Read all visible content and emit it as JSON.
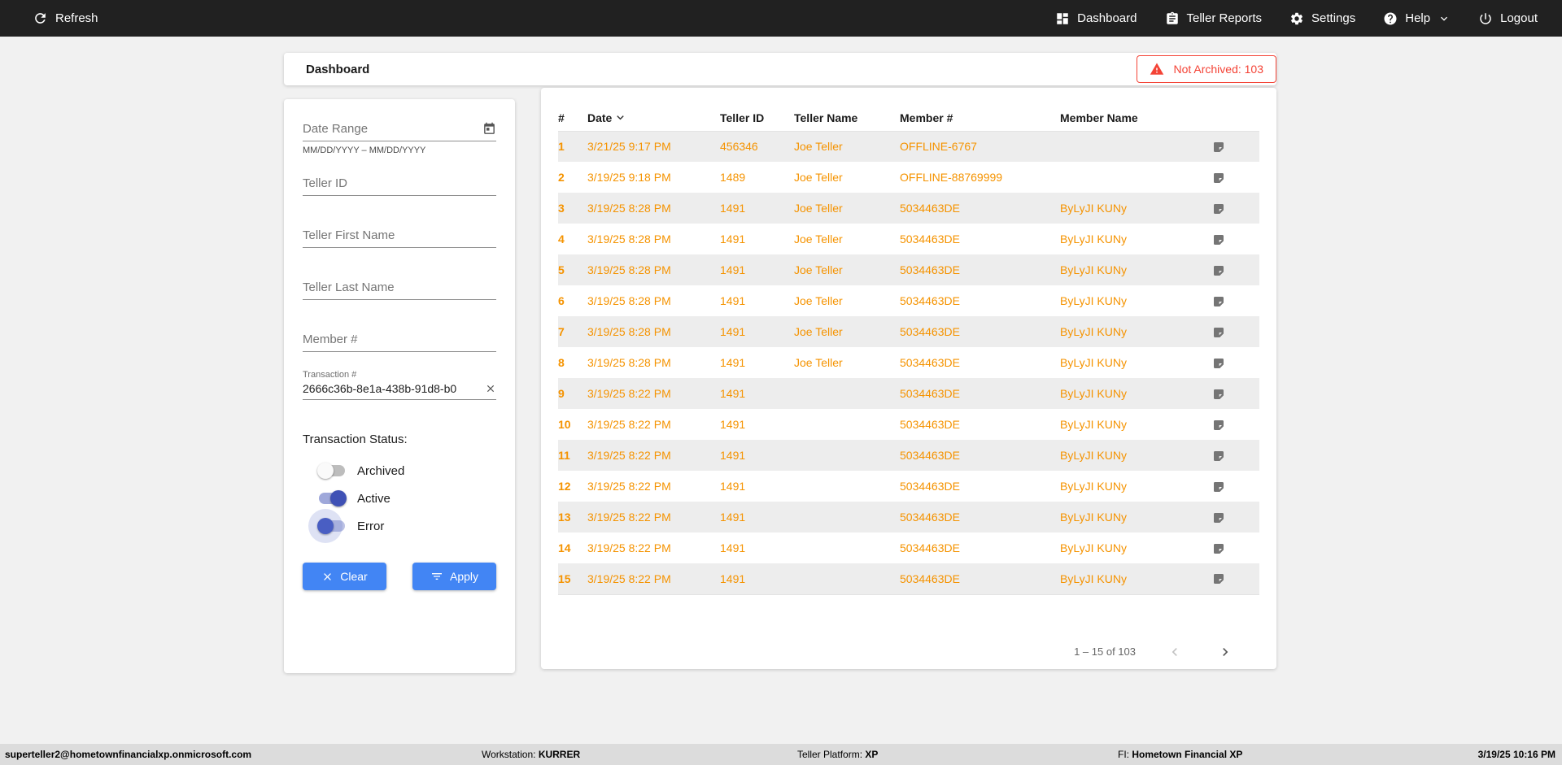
{
  "topbar": {
    "refresh_label": "Refresh",
    "nav": [
      {
        "label": "Dashboard"
      },
      {
        "label": "Teller Reports"
      },
      {
        "label": "Settings"
      },
      {
        "label": "Help"
      },
      {
        "label": "Logout"
      }
    ]
  },
  "header": {
    "title": "Dashboard",
    "not_archived_label": "Not Archived: 103"
  },
  "filters": {
    "date_range_placeholder": "Date Range",
    "date_range_helper": "MM/DD/YYYY – MM/DD/YYYY",
    "teller_id_placeholder": "Teller ID",
    "teller_first_name_placeholder": "Teller First Name",
    "teller_last_name_placeholder": "Teller Last Name",
    "member_number_placeholder": "Member #",
    "transaction_label": "Transaction #",
    "transaction_value": "2666c36b-8e1a-438b-91d8-b0",
    "status_label": "Transaction Status:",
    "toggles": [
      {
        "label": "Archived",
        "on": false,
        "halo": false
      },
      {
        "label": "Active",
        "on": true,
        "halo": false
      },
      {
        "label": "Error",
        "on": false,
        "halo": true
      }
    ],
    "clear_label": "Clear",
    "apply_label": "Apply"
  },
  "table": {
    "columns": [
      "#",
      "Date",
      "Teller ID",
      "Teller Name",
      "Member #",
      "Member Name"
    ],
    "rows": [
      {
        "num": "1",
        "date": "3/21/25 9:17 PM",
        "teller_id": "456346",
        "teller_name": "Joe Teller",
        "member_number": "OFFLINE-6767",
        "member_name": ""
      },
      {
        "num": "2",
        "date": "3/19/25 9:18 PM",
        "teller_id": "1489",
        "teller_name": "Joe Teller",
        "member_number": "OFFLINE-88769999",
        "member_name": ""
      },
      {
        "num": "3",
        "date": "3/19/25 8:28 PM",
        "teller_id": "1491",
        "teller_name": "Joe Teller",
        "member_number": "5034463DE",
        "member_name": "ByLyJI KUNy"
      },
      {
        "num": "4",
        "date": "3/19/25 8:28 PM",
        "teller_id": "1491",
        "teller_name": "Joe Teller",
        "member_number": "5034463DE",
        "member_name": "ByLyJI KUNy"
      },
      {
        "num": "5",
        "date": "3/19/25 8:28 PM",
        "teller_id": "1491",
        "teller_name": "Joe Teller",
        "member_number": "5034463DE",
        "member_name": "ByLyJI KUNy"
      },
      {
        "num": "6",
        "date": "3/19/25 8:28 PM",
        "teller_id": "1491",
        "teller_name": "Joe Teller",
        "member_number": "5034463DE",
        "member_name": "ByLyJI KUNy"
      },
      {
        "num": "7",
        "date": "3/19/25 8:28 PM",
        "teller_id": "1491",
        "teller_name": "Joe Teller",
        "member_number": "5034463DE",
        "member_name": "ByLyJI KUNy"
      },
      {
        "num": "8",
        "date": "3/19/25 8:28 PM",
        "teller_id": "1491",
        "teller_name": "Joe Teller",
        "member_number": "5034463DE",
        "member_name": "ByLyJI KUNy"
      },
      {
        "num": "9",
        "date": "3/19/25 8:22 PM",
        "teller_id": "1491",
        "teller_name": "",
        "member_number": "5034463DE",
        "member_name": "ByLyJI KUNy"
      },
      {
        "num": "10",
        "date": "3/19/25 8:22 PM",
        "teller_id": "1491",
        "teller_name": "",
        "member_number": "5034463DE",
        "member_name": "ByLyJI KUNy"
      },
      {
        "num": "11",
        "date": "3/19/25 8:22 PM",
        "teller_id": "1491",
        "teller_name": "",
        "member_number": "5034463DE",
        "member_name": "ByLyJI KUNy"
      },
      {
        "num": "12",
        "date": "3/19/25 8:22 PM",
        "teller_id": "1491",
        "teller_name": "",
        "member_number": "5034463DE",
        "member_name": "ByLyJI KUNy"
      },
      {
        "num": "13",
        "date": "3/19/25 8:22 PM",
        "teller_id": "1491",
        "teller_name": "",
        "member_number": "5034463DE",
        "member_name": "ByLyJI KUNy"
      },
      {
        "num": "14",
        "date": "3/19/25 8:22 PM",
        "teller_id": "1491",
        "teller_name": "",
        "member_number": "5034463DE",
        "member_name": "ByLyJI KUNy"
      },
      {
        "num": "15",
        "date": "3/19/25 8:22 PM",
        "teller_id": "1491",
        "teller_name": "",
        "member_number": "5034463DE",
        "member_name": "ByLyJI KUNy"
      }
    ],
    "pagination_range": "1 – 15 of 103"
  },
  "footer": {
    "user_email": "superteller2@hometownfinancialxp.onmicrosoft.com",
    "workstation_label": "Workstation:",
    "workstation_value": "KURRER",
    "teller_platform_label": "Teller Platform:",
    "teller_platform_value": "XP",
    "fi_label": "FI:",
    "fi_value": "Hometown Financial XP",
    "datetime": "3/19/25 10:16 PM"
  },
  "colors": {
    "accent_blue": "#4285f4",
    "toggle_blue": "#3f51b5",
    "data_orange": "#f59300",
    "alert_red": "#f44336",
    "topbar_dark": "#212121"
  }
}
